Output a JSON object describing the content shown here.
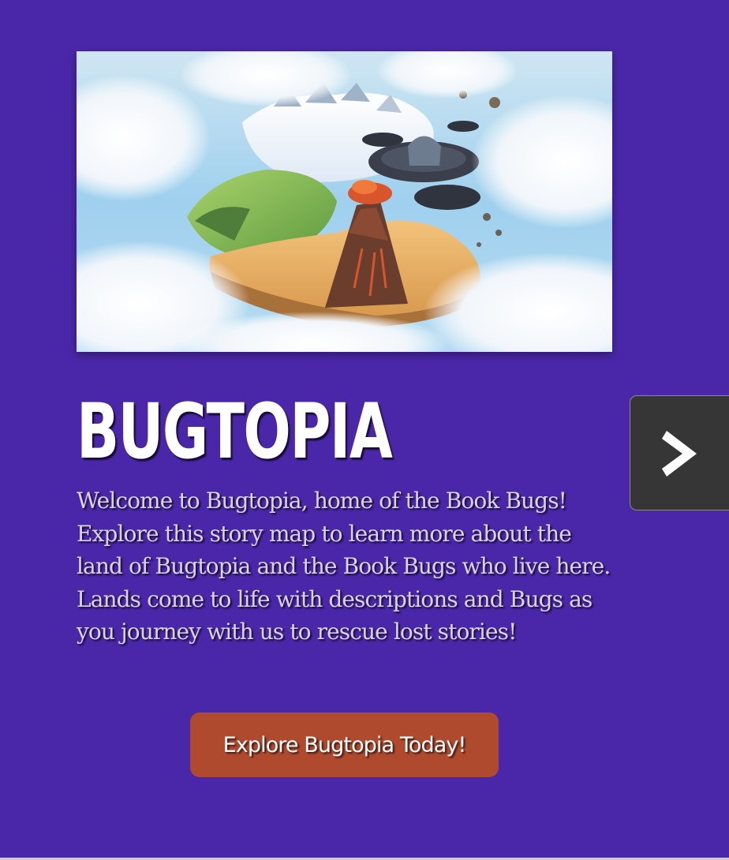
{
  "hero": {
    "image_alt": "Bugtopia story map illustration"
  },
  "title": "BUGTOPIA",
  "description": "Welcome to Bugtopia, home of the Book Bugs! Explore this story map to learn more about the land of Bugtopia and the Book Bugs who live here. Lands come to life with descriptions and Bugs as you journey with us to rescue lost stories!",
  "cta": {
    "label": "Explore Bugtopia Today!"
  },
  "next_button": {
    "icon": "chevron-right-icon"
  },
  "colors": {
    "background": "#4a27a8",
    "cta": "#b04a2f",
    "next_button": "#363636"
  }
}
